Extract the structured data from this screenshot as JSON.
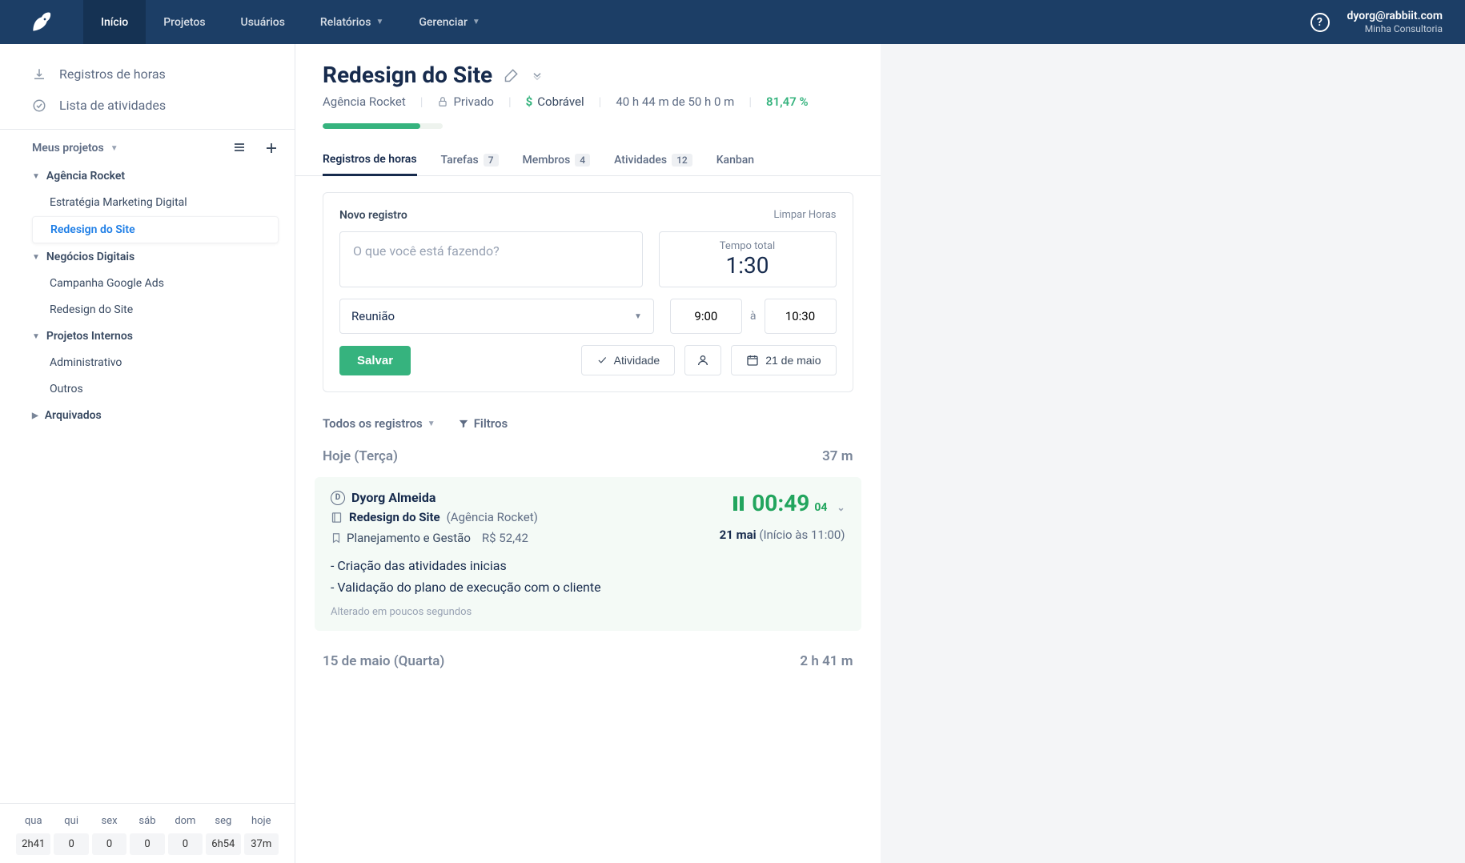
{
  "nav": {
    "items": [
      "Início",
      "Projetos",
      "Usuários",
      "Relatórios",
      "Gerenciar"
    ],
    "user_email": "dyorg@rabbiit.com",
    "user_sub": "Minha Consultoria"
  },
  "sidebar": {
    "link_timelogs": "Registros de horas",
    "link_activities": "Lista de atividades",
    "section_title": "Meus projetos",
    "groups": [
      {
        "name": "Agência Rocket",
        "items": [
          "Estratégia Marketing Digital",
          "Redesign do Site"
        ]
      },
      {
        "name": "Negócios Digitais",
        "items": [
          "Campanha Google Ads",
          "Redesign do Site"
        ]
      },
      {
        "name": "Projetos Internos",
        "items": [
          "Administrativo",
          "Outros"
        ]
      }
    ],
    "archived_label": "Arquivados",
    "week": {
      "days": [
        "qua",
        "qui",
        "sex",
        "sáb",
        "dom",
        "seg",
        "hoje"
      ],
      "vals": [
        "2h41",
        "0",
        "0",
        "0",
        "0",
        "6h54",
        "37m"
      ]
    }
  },
  "project": {
    "title": "Redesign do Site",
    "client": "Agência Rocket",
    "privacy": "Privado",
    "billable": "Cobrável",
    "hours": "40 h 44 m de 50 h 0 m",
    "percent": "81,47 %",
    "progress": 81.47
  },
  "tabs": [
    {
      "label": "Registros de horas",
      "count": ""
    },
    {
      "label": "Tarefas",
      "count": "7"
    },
    {
      "label": "Membros",
      "count": "4"
    },
    {
      "label": "Atividades",
      "count": "12"
    },
    {
      "label": "Kanban",
      "count": ""
    }
  ],
  "new_entry": {
    "title": "Novo registro",
    "clear": "Limpar Horas",
    "placeholder": "O que você está fazendo?",
    "total_label": "Tempo total",
    "total_value": "1:30",
    "task_value": "Reunião",
    "start_time": "9:00",
    "to_label": "à",
    "end_time": "10:30",
    "save": "Salvar",
    "activity_btn": "Atividade",
    "date_btn": "21 de maio"
  },
  "filters": {
    "all": "Todos os registros",
    "filters": "Filtros"
  },
  "today": {
    "label": "Hoje (Terça)",
    "total": "37 m",
    "entry": {
      "user": "Dyorg Almeida",
      "badge": "D",
      "project": "Redesign do Site",
      "client": "(Agência Rocket)",
      "task": "Planejamento e Gestão",
      "cost": "R$ 52,42",
      "desc1": "- Criação das atividades inicias",
      "desc2": "- Validação do plano de execução com o cliente",
      "changed": "Alterado em poucos segundos",
      "timer": "00:49",
      "timer_sec": "04",
      "date": "21 mai",
      "start": "(Início às 11:00)"
    }
  },
  "prev_day": {
    "label": "15 de maio (Quarta)",
    "total": "2 h 41 m"
  }
}
